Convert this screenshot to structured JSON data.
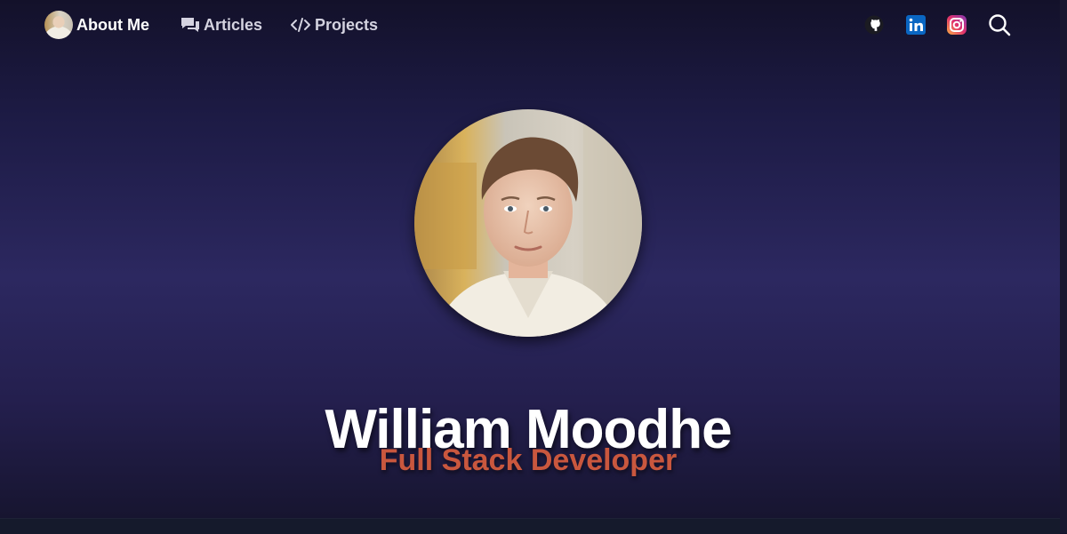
{
  "nav": {
    "about_label": "About Me",
    "articles_label": "Articles",
    "projects_label": "Projects",
    "social": [
      "github-icon",
      "linkedin-icon",
      "instagram-icon"
    ],
    "search_icon": "search-icon"
  },
  "hero": {
    "name": "William Moodhe",
    "role": "Full Stack Developer"
  },
  "colors": {
    "accent": "#c9573e",
    "background_top": "#13112a",
    "background_mid": "#2c2860",
    "linkedin": "#0a66c2"
  }
}
